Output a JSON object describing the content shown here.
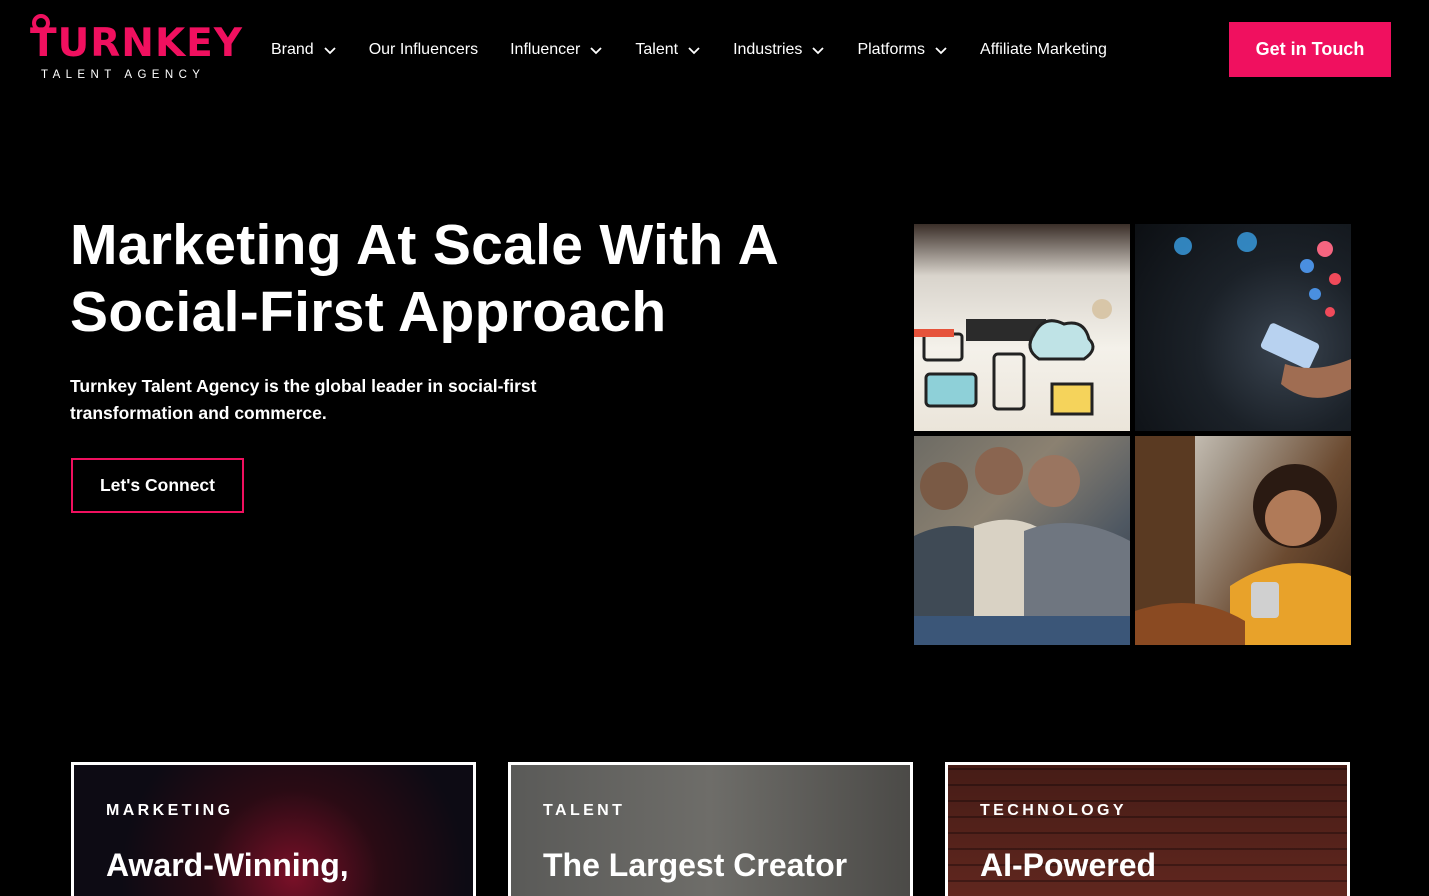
{
  "colors": {
    "accent": "#f0105f",
    "background": "#000000",
    "text": "#ffffff"
  },
  "logo": {
    "brand": "TURNKEY",
    "tagline": "TALENT AGENCY"
  },
  "nav": {
    "items": [
      {
        "label": "Brand",
        "dropdown": true
      },
      {
        "label": "Our Influencers",
        "dropdown": false
      },
      {
        "label": "Influencer",
        "dropdown": true
      },
      {
        "label": "Talent",
        "dropdown": true
      },
      {
        "label": "Industries",
        "dropdown": true
      },
      {
        "label": "Platforms",
        "dropdown": true
      },
      {
        "label": "Affiliate Marketing",
        "dropdown": false
      }
    ],
    "cta_label": "Get in Touch"
  },
  "hero": {
    "title_line1": "Marketing At Scale With A",
    "title_line2": "Social-First Approach",
    "subtitle": "Turnkey Talent Agency is the global leader in social-first transformation and commerce.",
    "button_label": "Let's Connect"
  },
  "cards": [
    {
      "eyebrow": "MARKETING",
      "title": "Award-Winning,"
    },
    {
      "eyebrow": "TALENT",
      "title": "The Largest Creator"
    },
    {
      "eyebrow": "TECHNOLOGY",
      "title": "AI-Powered"
    }
  ]
}
